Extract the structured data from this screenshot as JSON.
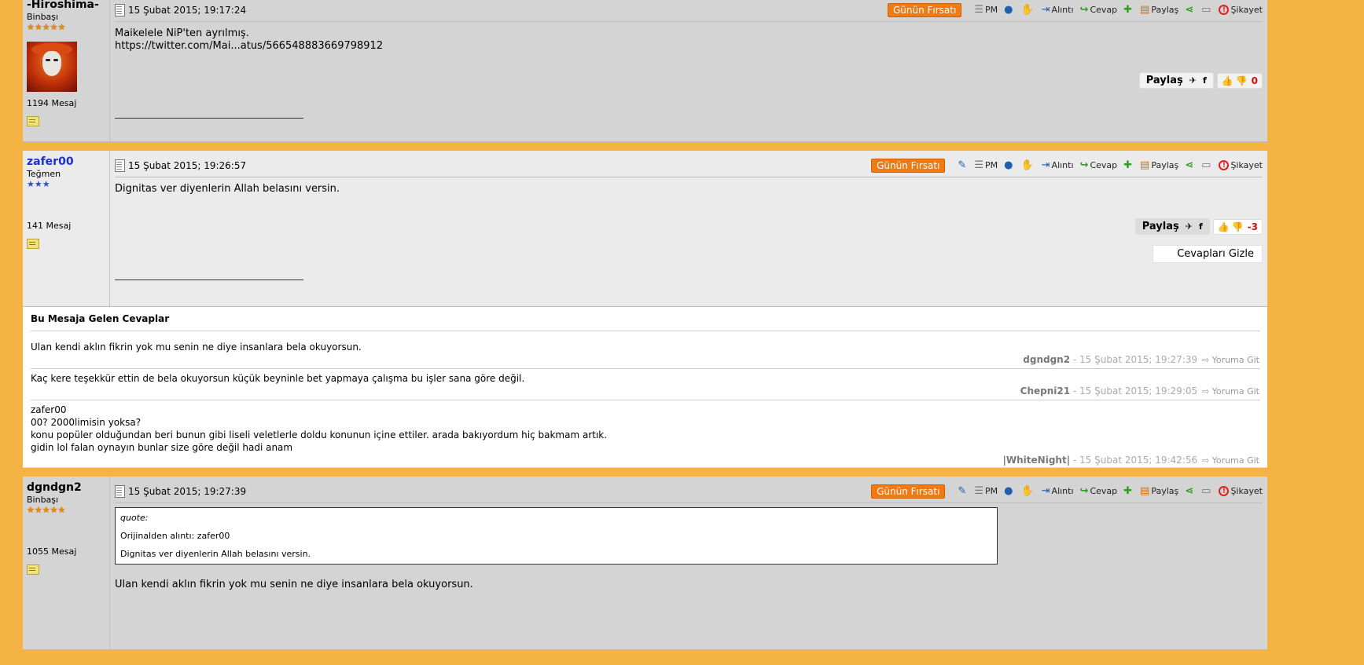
{
  "toolbar_labels": {
    "deal": "Günün Fırsatı",
    "pm": "PM",
    "quote": "Alıntı",
    "reply": "Cevap",
    "share": "Paylaş",
    "report": "Şikayet"
  },
  "share_label": "Paylaş",
  "posts": [
    {
      "username": "-Hiroshima-",
      "rank": "Binbaşı",
      "stars": "★★★★★",
      "msg_count": "1194 Mesaj",
      "date": "15 Şubat 2015; 19:17:24",
      "body_line1": "Maikelele NiP'ten ayrılmış.",
      "body_line2": "https://twitter.com/Mai...atus/566548883669798912",
      "score": "0"
    },
    {
      "username": "zafer00",
      "rank": "Teğmen",
      "stars": "★★★",
      "msg_count": "141 Mesaj",
      "date": "15 Şubat 2015; 19:26:57",
      "body_line1": "Dignitas ver diyenlerin Allah belasını versin.",
      "score": "-3",
      "hide_replies": "Cevapları Gizle"
    },
    {
      "username": "dgndgn2",
      "rank": "Binbaşı",
      "stars": "★★★★★",
      "msg_count": "1055 Mesaj",
      "date": "15 Şubat 2015; 19:27:39",
      "quote_label": "quote:",
      "quote_source": "Orijinalden alıntı: zafer00",
      "quote_text": "Dignitas ver diyenlerin Allah belasını versin.",
      "body_line1": "Ulan kendi aklın fikrin yok mu senin ne diye insanlara bela okuyorsun."
    }
  ],
  "replies": {
    "title": "Bu Mesaja Gelen Cevaplar",
    "go_label": "Yoruma Git",
    "items": [
      {
        "text": "Ulan kendi aklın fikrin yok mu senin ne diye insanlara bela okuyorsun.",
        "author": "dgndgn2",
        "date": " - 15 Şubat 2015; 19:27:39"
      },
      {
        "text": "Kaç kere teşekkür ettin de bela okuyorsun küçük beyninle bet yapmaya çalışma bu işler sana göre değil.",
        "author": "Chepni21",
        "date": " - 15 Şubat 2015; 19:29:05"
      },
      {
        "text": "zafer00\n00? 2000limisin yoksa?\nkonu popüler olduğundan beri bunun gibi liseli veletlerle doldu konunun içine ettiler. arada bakıyordum hiç bakmam artık.\ngidin lol falan oynayın bunlar size göre değil hadi anam",
        "author": "|WhiteNight|",
        "date": " - 15 Şubat 2015; 19:42:56"
      }
    ]
  },
  "colors": {
    "page_background": "#f4b342",
    "deal_button": "#f07a14",
    "score_negative": "#d01010",
    "username_blue": "#1a2fd8"
  }
}
